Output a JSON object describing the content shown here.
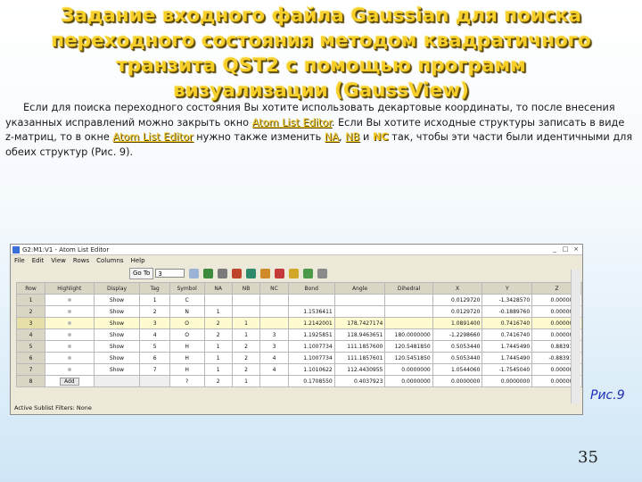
{
  "slide": {
    "title_lines": [
      "Задание входного файла Gaussian для поиска",
      "переходного состояния методом квадратичного",
      "транзита QST2 с помощью программ",
      "визуализации (GaussView)"
    ],
    "paragraph": {
      "p1": "Если для поиска переходного состояния Вы хотите использовать декартовые координаты, то после внесения указанных исправлений можно закрыть окно ",
      "link1": "Atom List Editor",
      "p2": ". Если Вы хотите исходные структуры записать в виде z-матриц, то в окне ",
      "link2": "Atom List Editor",
      "p3": " нужно также изменить ",
      "na": "NA",
      "sep": ", ",
      "nb": "NB",
      "and": " и ",
      "nc": "NC",
      "p4": " так, чтобы эти части были идентичными для обеих структур (Рис. 9)."
    },
    "figure_caption": "Рис.9",
    "page_number": "35"
  },
  "window": {
    "title": "G2:M1:V1 - Atom List Editor",
    "buttons": {
      "minimize": "_",
      "maximize": "□",
      "close": "×"
    },
    "menu": [
      "File",
      "Edit",
      "View",
      "Rows",
      "Columns",
      "Help"
    ],
    "toolbar": {
      "goto_label": "Go To",
      "goto_value": "3"
    },
    "columns": [
      "Row",
      "Highlight",
      "Display",
      "Tag",
      "Symbol",
      "NA",
      "NB",
      "NC",
      "Bond",
      "Angle",
      "Dihedral",
      "X",
      "Y",
      "Z"
    ],
    "rows": [
      [
        "1",
        "",
        "Show",
        "1",
        "C",
        "",
        "",
        "",
        "",
        "",
        "",
        "0.0129720",
        "-1.3428570",
        "0.0000000"
      ],
      [
        "2",
        "",
        "Show",
        "2",
        "N",
        "1",
        "",
        "",
        "1.1536411",
        "",
        "",
        "0.0129720",
        "-0.1889760",
        "0.0000000"
      ],
      [
        "3",
        "",
        "Show",
        "3",
        "O",
        "2",
        "1",
        "",
        "1.2142001",
        "178.7427174",
        "",
        "1.0891400",
        "0.7416740",
        "0.0000000"
      ],
      [
        "4",
        "",
        "Show",
        "4",
        "O",
        "2",
        "1",
        "3",
        "1.1925851",
        "118.9463651",
        "180.0000000",
        "-1.2298660",
        "0.7416740",
        "0.0000000"
      ],
      [
        "5",
        "",
        "Show",
        "5",
        "H",
        "1",
        "2",
        "3",
        "1.1007734",
        "111.1857600",
        "120.5481850",
        "0.5053440",
        "1.7445490",
        "0.8839170"
      ],
      [
        "6",
        "",
        "Show",
        "6",
        "H",
        "1",
        "2",
        "4",
        "1.1007734",
        "111.1857601",
        "120.5451850",
        "0.5053440",
        "1.7445490",
        "-0.8839170"
      ],
      [
        "7",
        "",
        "Show",
        "7",
        "H",
        "1",
        "2",
        "4",
        "1.1010622",
        "112.4430955",
        "0.0000000",
        "1.0544060",
        "-1.7545040",
        "0.0000000"
      ],
      [
        "8",
        "Add",
        "",
        "",
        "?",
        "2",
        "1",
        "",
        "0.1708550",
        "0.4037923",
        "0.0000000",
        "0.0000000",
        "0.0000000",
        "0.0000000"
      ]
    ],
    "selected_row": 2,
    "status": "Active Sublist Filters:  None"
  }
}
